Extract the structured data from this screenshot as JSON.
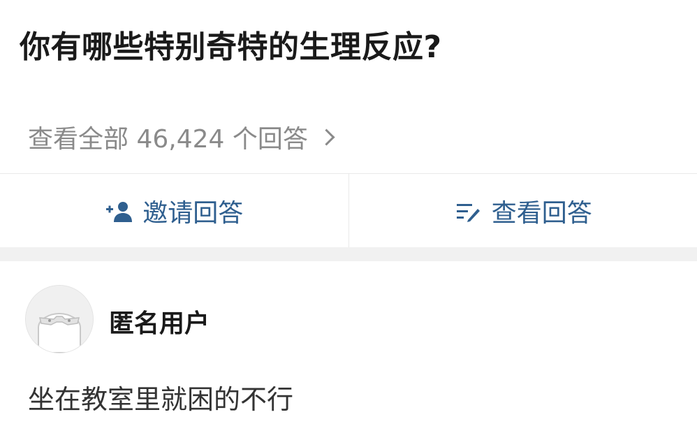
{
  "question": {
    "title": "你有哪些特别奇特的生理反应?"
  },
  "answers_summary": {
    "view_all_text": "查看全部 46,424 个回答"
  },
  "actions": {
    "invite_label": "邀请回答",
    "view_label": "查看回答"
  },
  "answer": {
    "author": "匿名用户",
    "content": "坐在教室里就困的不行"
  },
  "colors": {
    "accent": "#2f5f8f",
    "muted": "#8a8a8a",
    "text": "#1a1a1a",
    "separator": "#f1f1f1"
  },
  "icons": {
    "invite": "add-user-icon",
    "view": "edit-list-icon",
    "chevron": "chevron-right-icon",
    "avatar": "anonymous-avatar-icon"
  }
}
